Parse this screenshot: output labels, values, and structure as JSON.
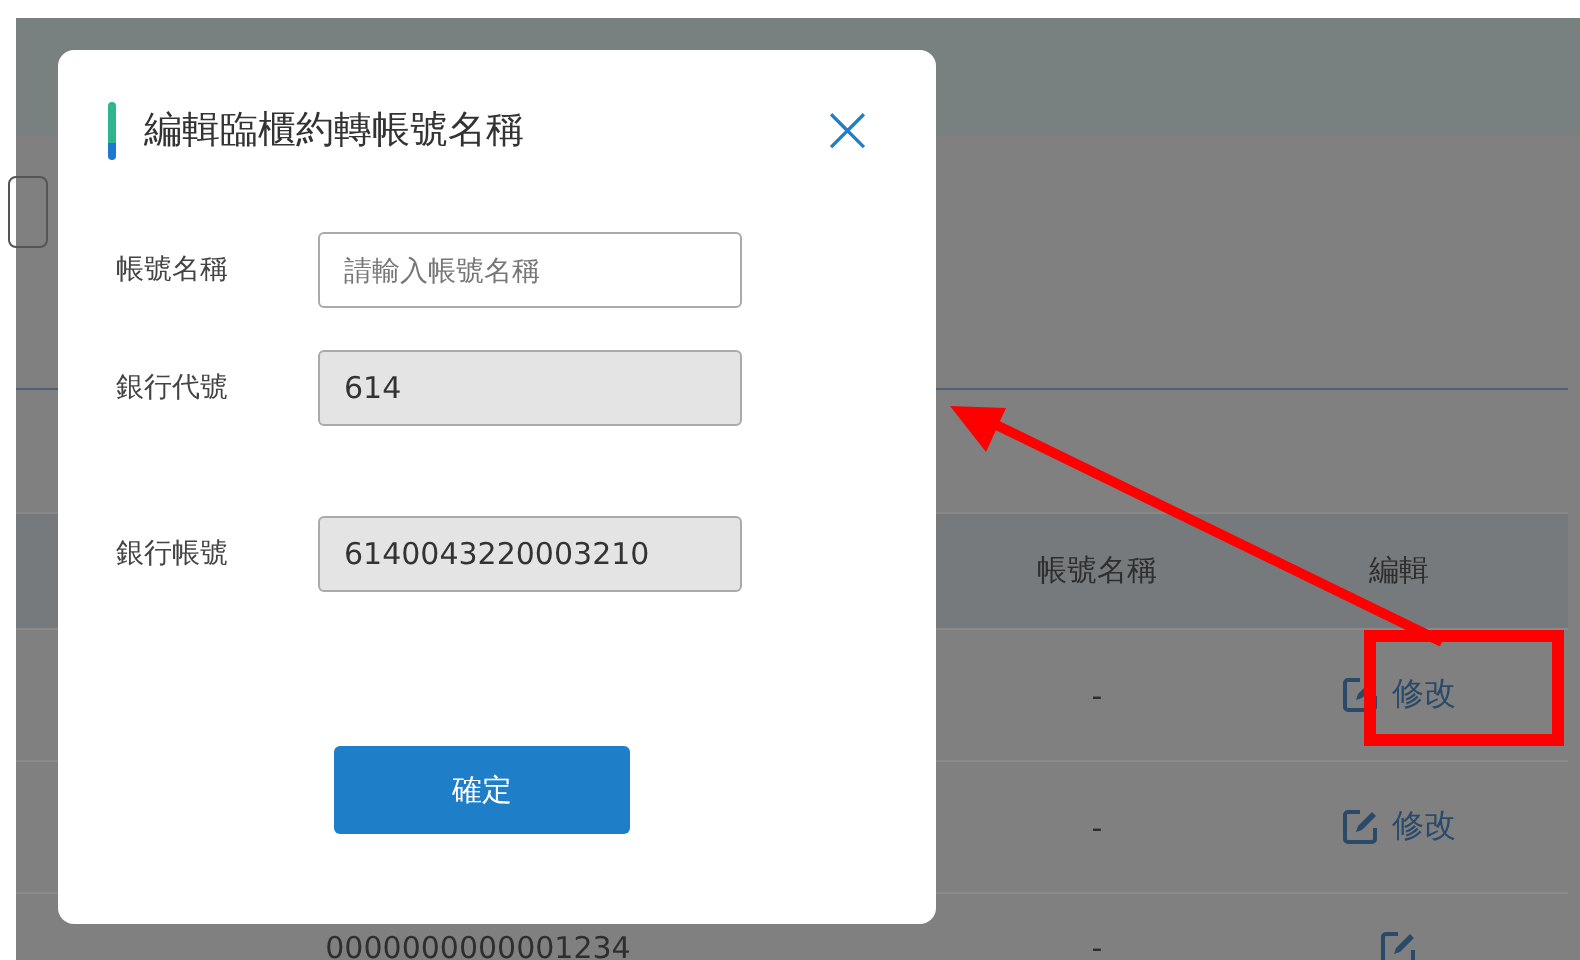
{
  "table": {
    "columns": [
      "帳號名稱",
      "編輯"
    ],
    "rows": [
      {
        "name": "-",
        "edit": "修改"
      },
      {
        "name": "-",
        "edit": "修改"
      },
      {
        "account": "0000000000001234",
        "name": "-"
      }
    ]
  },
  "dialog": {
    "title": "編輯臨櫃約轉帳號名稱",
    "close": "×",
    "fields": [
      {
        "label": "帳號名稱",
        "placeholder": "請輸入帳號名稱",
        "disabled": false
      },
      {
        "label": "銀行代號",
        "value": "614",
        "disabled": true
      },
      {
        "label": "銀行帳號",
        "value": "6140043220003210",
        "disabled": true
      }
    ],
    "confirm": "確定"
  }
}
